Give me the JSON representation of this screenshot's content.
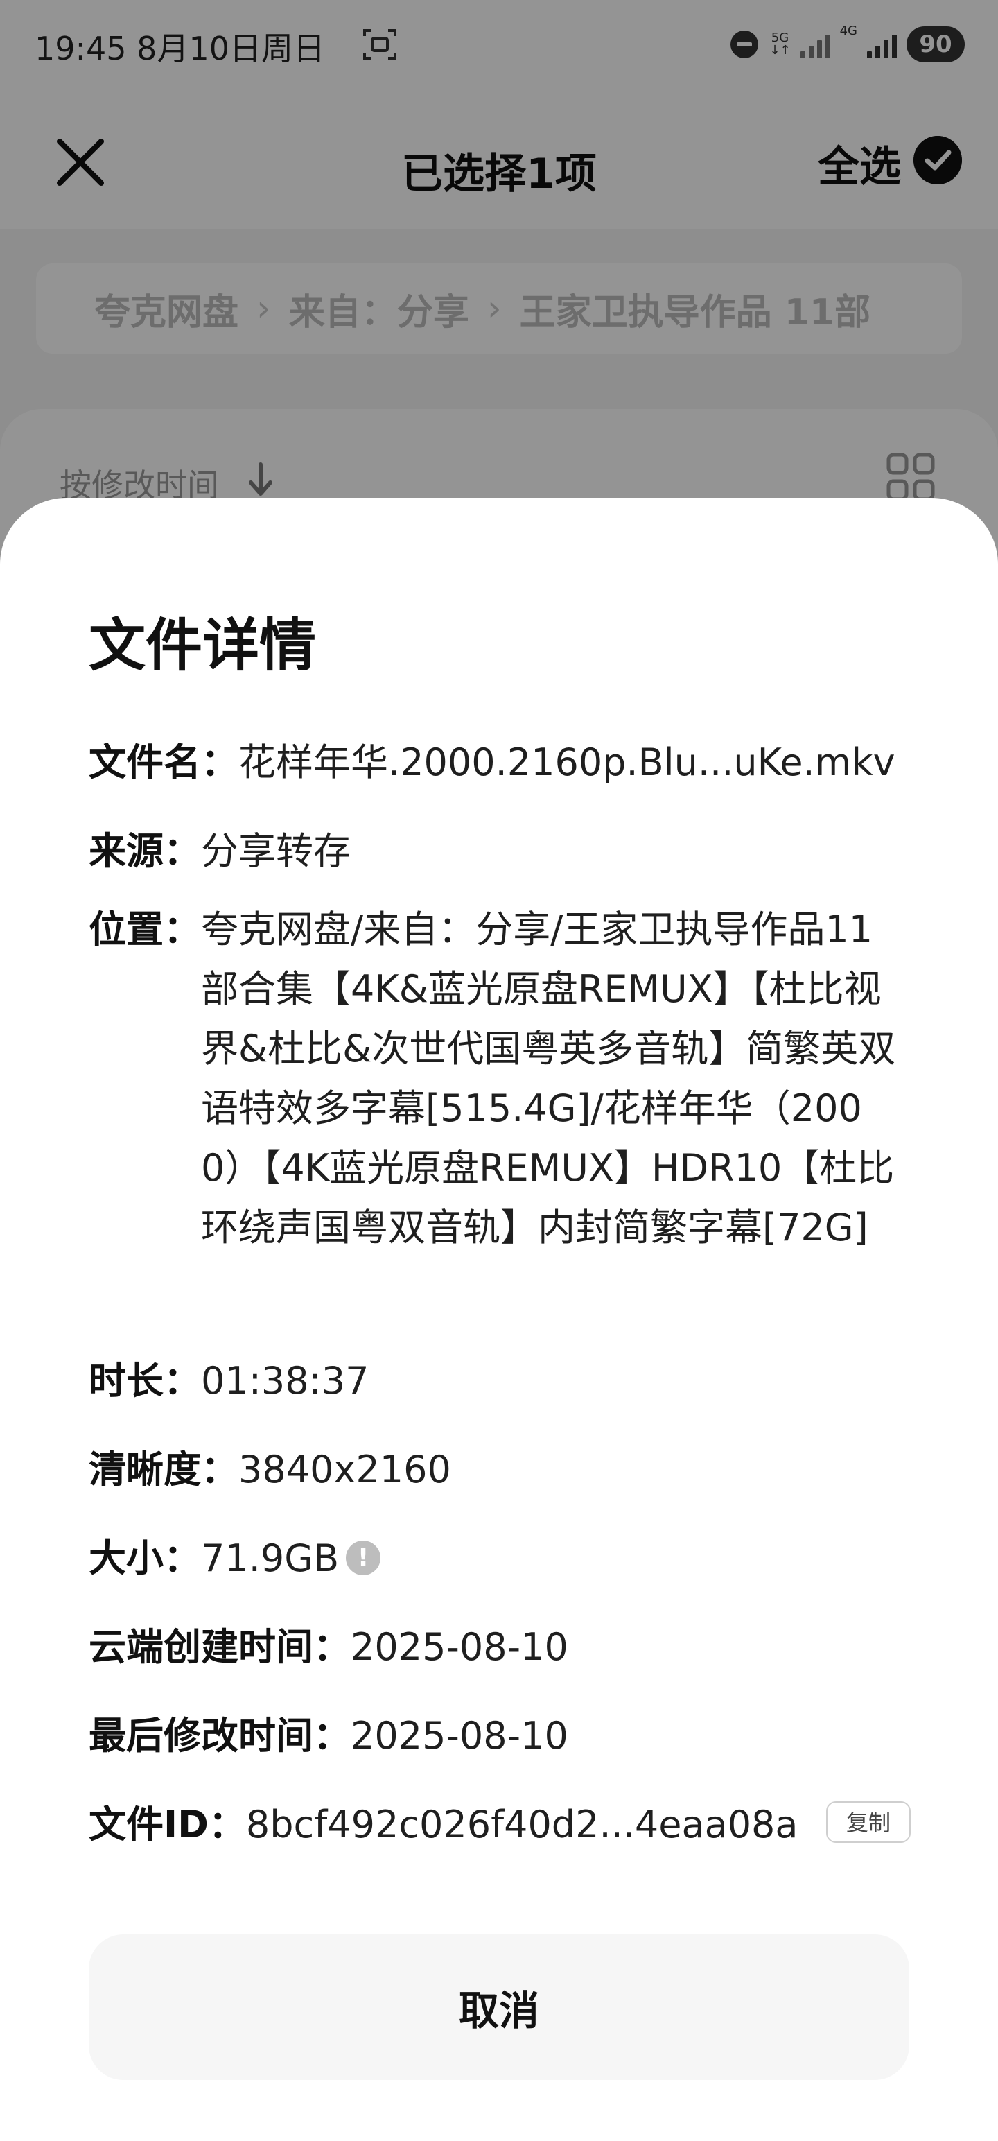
{
  "status_bar": {
    "time": "19:45  8月10日周日",
    "network_5g": "5G",
    "network_4g": "4G",
    "battery": "90"
  },
  "header": {
    "title": "已选择1项",
    "select_all": "全选"
  },
  "breadcrumb": {
    "items": [
      "夸克网盘",
      "来自：分享",
      "王家卫执导作品 11部"
    ],
    "separator": "›"
  },
  "list": {
    "sort_label": "按修改时间"
  },
  "sheet": {
    "title": "文件详情",
    "filename_label": "文件名：",
    "filename_value": "花样年华.2000.2160p.Blu...uKe.mkv",
    "source_label": "来源：",
    "source_value": "分享转存",
    "location_label": "位置：",
    "location_value": "夸克网盘/来自：分享/王家卫执导作品11部合集【4K&蓝光原盘REMUX】【杜比视界&杜比&次世代国粤英多音轨】简繁英双语特效多字幕[515.4G]/花样年华（2000）【4K蓝光原盘REMUX】HDR10【杜比环绕声国粤双音轨】内封简繁字幕[72G]",
    "duration_label": "时长：",
    "duration_value": "01:38:37",
    "resolution_label": "清晰度：",
    "resolution_value": "3840x2160",
    "size_label": "大小：",
    "size_value": "71.9GB",
    "size_info_glyph": "!",
    "cloud_created_label": "云端创建时间：",
    "cloud_created_value": "2025-08-10",
    "modified_label": "最后修改时间：",
    "modified_value": "2025-08-10",
    "file_id_label": "文件ID：",
    "file_id_value": "8bcf492c026f40d2...4eaa08a",
    "copy_label": "复制",
    "cancel_label": "取消"
  },
  "colors": {
    "overlay": "#000000",
    "sheet_bg": "#ffffff",
    "cancel_bg": "#f6f6f6",
    "text_primary": "#111111"
  }
}
